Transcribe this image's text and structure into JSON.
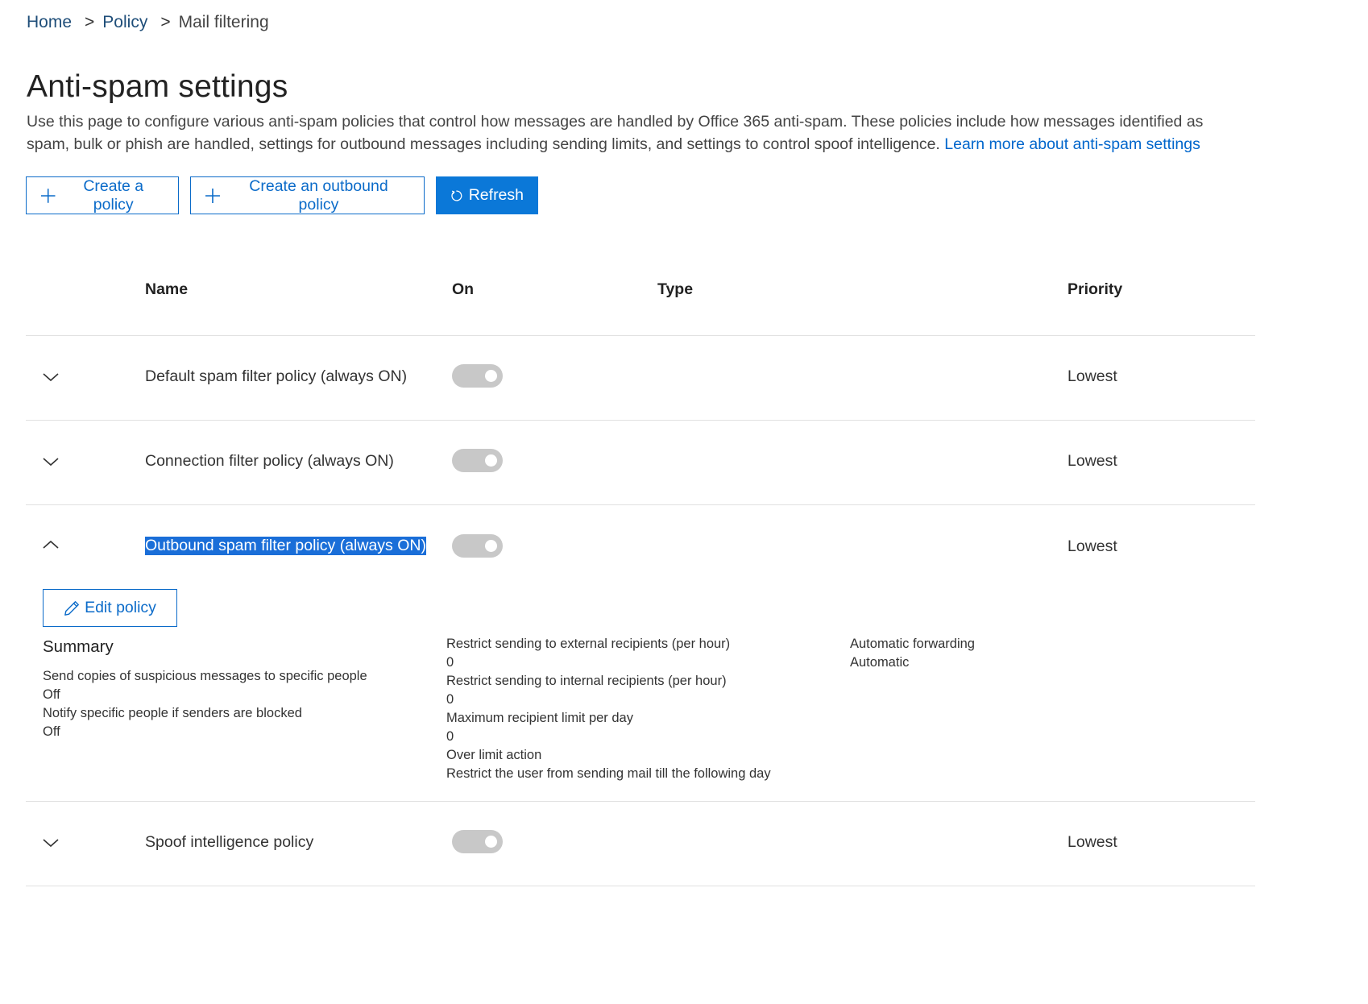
{
  "breadcrumb": {
    "home": "Home",
    "separator": ">",
    "policy": "Policy",
    "current": "Mail filtering"
  },
  "page": {
    "title": "Anti-spam settings",
    "description": "Use this page to configure various anti-spam policies that control how messages are handled by Office 365 anti-spam. These policies include how messages identified as spam, bulk or phish are handled, settings for outbound messages including sending limits, and settings to control spoof intelligence.",
    "learn_more": "Learn more about anti-spam settings"
  },
  "actions": {
    "create_policy": "Create a policy",
    "create_outbound": "Create an outbound policy",
    "refresh": "Refresh"
  },
  "table": {
    "headers": {
      "name": "Name",
      "on": "On",
      "type": "Type",
      "priority": "Priority"
    },
    "rows": [
      {
        "name": "Default spam filter policy (always ON)",
        "priority": "Lowest",
        "on": true,
        "expanded": false
      },
      {
        "name": "Connection filter policy (always ON)",
        "priority": "Lowest",
        "on": true,
        "expanded": false
      },
      {
        "name": "Outbound spam filter policy (always ON)",
        "priority": "Lowest",
        "on": true,
        "expanded": true
      },
      {
        "name": "Spoof intelligence policy",
        "priority": "Lowest",
        "on": true,
        "expanded": false
      }
    ]
  },
  "details": {
    "edit_label": "Edit policy",
    "summary_title": "Summary",
    "col1": [
      "Send copies of suspicious messages to specific people",
      "Off",
      "Notify specific people if senders are blocked",
      "Off"
    ],
    "col2": [
      "Restrict sending to external recipients (per hour)",
      "0",
      "Restrict sending to internal recipients (per hour)",
      "0",
      "Maximum recipient limit per day",
      "0",
      "Over limit action",
      "Restrict the user from sending mail till the following day"
    ],
    "col3": [
      "Automatic forwarding",
      "Automatic"
    ]
  },
  "colors": {
    "accent": "#0b78d8",
    "link": "#0066cc",
    "selection": "#1a6ed8",
    "toggle_disabled": "#c8c8c8"
  }
}
